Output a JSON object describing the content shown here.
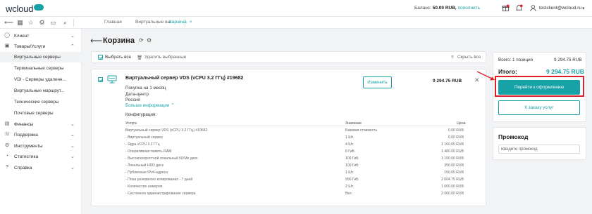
{
  "app": {
    "logo_text": "wcloud"
  },
  "topbar": {
    "balance_label": "Баланс:",
    "balance_value": "50.00 RUB,",
    "topup_label": "пополнить",
    "user_email": "testclient@wcloud.ru"
  },
  "tabs": [
    {
      "label": "Главная"
    },
    {
      "label": "Виртуальные вы..."
    },
    {
      "label": "Корзина",
      "close": "×"
    }
  ],
  "sidebar": {
    "items": [
      {
        "label": "Клиент"
      },
      {
        "label": "Товары/Услуги"
      },
      {
        "label": "Финансы"
      },
      {
        "label": "Поддержка"
      },
      {
        "label": "Инструменты"
      },
      {
        "label": "Статистика"
      },
      {
        "label": "Справка"
      }
    ],
    "subitems": [
      {
        "label": "Виртуальные серверы"
      },
      {
        "label": "Терминальные серверы"
      },
      {
        "label": "VDI - Серверы удаленн..."
      },
      {
        "label": "Виртуальные маршрут..."
      },
      {
        "label": "Технические серверы"
      },
      {
        "label": "Почтовые серверы"
      }
    ]
  },
  "page": {
    "title": "Корзина",
    "select_all": "Выбрать все",
    "delete_selected": "Удалить выбранные",
    "hide_all": "Скрыть все"
  },
  "cart_item": {
    "title": "Виртуальный сервер VDS (vCPU 3.2 ГГц) #19682",
    "purchase": "Покупка на 1 месяц",
    "datacenter_label": "Дата-центр",
    "country": "Россия",
    "more_info": "Больше информации",
    "edit_button": "Изменить",
    "price": "9 294.75 RUB",
    "config_title": "Конфигурация:",
    "config_headers": {
      "service": "Услуга",
      "value": "Значение",
      "price": "Цена"
    },
    "config_rows": [
      {
        "service": "Виртуальный сервер VDS (vCPU 3.2 ГГц) #19682",
        "value": "Базовая стоимость",
        "price": "0.00 RUB"
      },
      {
        "service": "- Виртуальный сервер",
        "value": "1 Шт.",
        "price": "0.00 RUB"
      },
      {
        "service": "- Ядра vCPU 3.2 ГГц",
        "value": "4 Шт.",
        "price": "1 160.00 RUB"
      },
      {
        "service": "- Оперативная память RAM",
        "value": "8 ГиБ",
        "price": "1 480.00 RUB"
      },
      {
        "service": "- Высокоскоростной локальный NVMe диск",
        "value": "100 ГиБ",
        "price": "1 150.00 RUB"
      },
      {
        "service": "- Локальный HDD диск",
        "value": "100 ГиБ",
        "price": "350.00 RUB"
      },
      {
        "service": "- Публичные IPv4-адреса",
        "value": "1 Шт.",
        "price": "150.00 RUB"
      },
      {
        "service": "- План резервного копирования - 7 дней",
        "value": "990 ГиБ",
        "price": "2 004.75 RUB"
      },
      {
        "service": "- Количество номеров",
        "value": "2 Шт.",
        "price": "1 000.00 RUB"
      },
      {
        "service": "- Системное администрирование сервера",
        "value": "Вкл.",
        "price": "2 000.00 RUB"
      }
    ]
  },
  "summary": {
    "count_label": "Всего: 1 позиция",
    "count_amount": "9 294.75 RUB",
    "total_label": "Итого:",
    "total_amount": "9 294.75 RUB",
    "checkout_button": "Перейти к оформлению",
    "back_button": "К заказу услуг"
  },
  "promo": {
    "title": "Промокод",
    "placeholder": "Введите промокод"
  },
  "colors": {
    "accent": "#17a2a7",
    "highlight": "#e11d2a"
  }
}
